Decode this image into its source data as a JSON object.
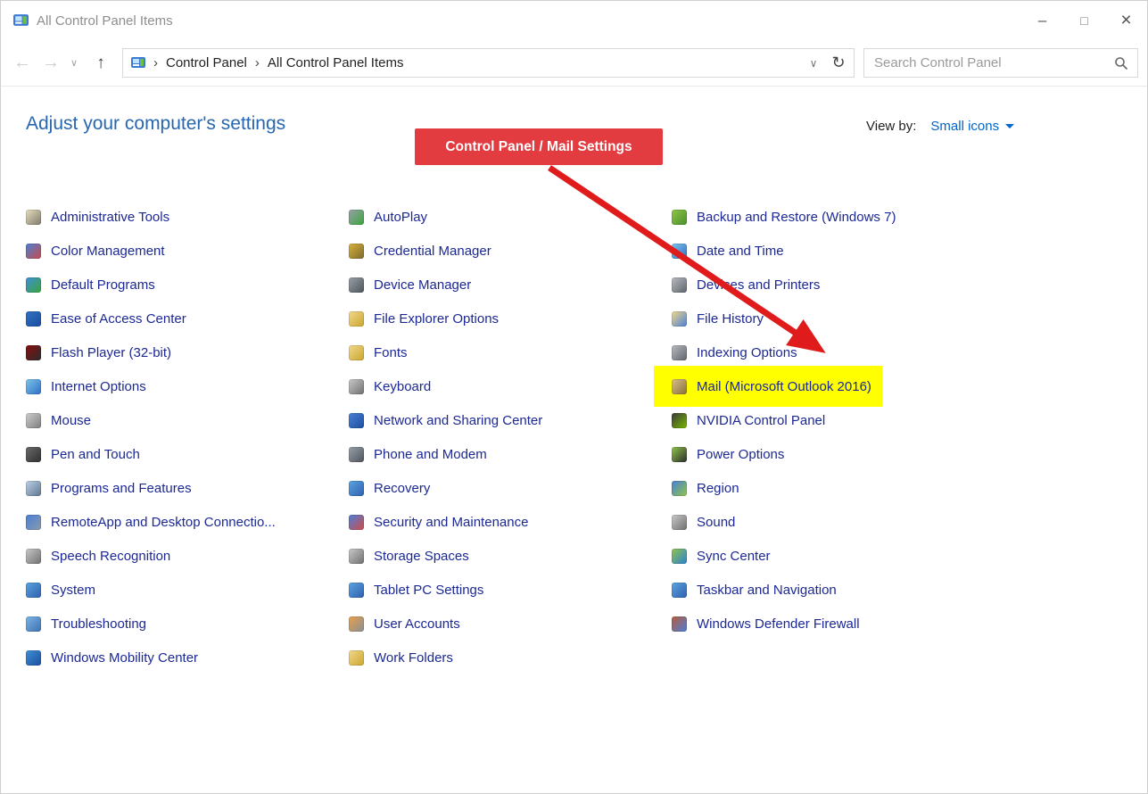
{
  "window": {
    "title": "All Control Panel Items",
    "controls": {
      "minimize": "–",
      "maximize": "□",
      "close": "×"
    }
  },
  "navbar": {
    "icons": {
      "back": "←",
      "forward": "→",
      "history_chevron": "∨",
      "up": "↑",
      "address_chevron": "∨",
      "refresh": "↻"
    },
    "separator": "›",
    "breadcrumb": [
      "Control Panel",
      "All Control Panel Items"
    ],
    "search_placeholder": "Search Control Panel"
  },
  "header": {
    "title": "Adjust your computer's settings",
    "view_by_label": "View by:",
    "view_by_value": "Small icons"
  },
  "annotation": {
    "callout_text": "Control Panel / Mail Settings",
    "callout_color": "#e23b40",
    "arrow_color": "#df1b1b",
    "highlight_color": "#ffff00"
  },
  "columns": [
    {
      "items": [
        {
          "label": "Administrative Tools",
          "icon": "administrative-tools-icon",
          "c1": "#e8ddbd",
          "c2": "#7f7a6b"
        },
        {
          "label": "Color Management",
          "icon": "color-management-icon",
          "c1": "#4a7fd6",
          "c2": "#c84b4b"
        },
        {
          "label": "Default Programs",
          "icon": "default-programs-icon",
          "c1": "#3f8fd6",
          "c2": "#39a53c"
        },
        {
          "label": "Ease of Access Center",
          "icon": "ease-of-access-icon",
          "c1": "#2f6fc4",
          "c2": "#1d4f9e"
        },
        {
          "label": "Flash Player (32-bit)",
          "icon": "flash-player-icon",
          "c1": "#8a0f0f",
          "c2": "#2b2b2b"
        },
        {
          "label": "Internet Options",
          "icon": "internet-options-icon",
          "c1": "#7ec4ea",
          "c2": "#2f6fc4"
        },
        {
          "label": "Mouse",
          "icon": "mouse-icon",
          "c1": "#cfcfcf",
          "c2": "#7d7d7d"
        },
        {
          "label": "Pen and Touch",
          "icon": "pen-and-touch-icon",
          "c1": "#6b6b6b",
          "c2": "#2f2f2f"
        },
        {
          "label": "Programs and Features",
          "icon": "programs-and-features-icon",
          "c1": "#bcd2ea",
          "c2": "#5f768e"
        },
        {
          "label": "RemoteApp and Desktop Connectio...",
          "icon": "remoteapp-icon",
          "c1": "#4a7fd6",
          "c2": "#8a9aac"
        },
        {
          "label": "Speech Recognition",
          "icon": "speech-recognition-icon",
          "c1": "#c9c9c9",
          "c2": "#6f6f6f"
        },
        {
          "label": "System",
          "icon": "system-icon",
          "c1": "#5aa5e0",
          "c2": "#2f5fae"
        },
        {
          "label": "Troubleshooting",
          "icon": "troubleshooting-icon",
          "c1": "#7ab6e8",
          "c2": "#3f6fb0"
        },
        {
          "label": "Windows Mobility Center",
          "icon": "windows-mobility-center-icon",
          "c1": "#3f8fd6",
          "c2": "#1d4f9e"
        }
      ]
    },
    {
      "items": [
        {
          "label": "AutoPlay",
          "icon": "autoplay-icon",
          "c1": "#9aa0a8",
          "c2": "#39a53c"
        },
        {
          "label": "Credential Manager",
          "icon": "credential-manager-icon",
          "c1": "#d9b13b",
          "c2": "#7c6a2e"
        },
        {
          "label": "Device Manager",
          "icon": "device-manager-icon",
          "c1": "#9aa0a8",
          "c2": "#4f555c"
        },
        {
          "label": "File Explorer Options",
          "icon": "file-explorer-options-icon",
          "c1": "#f2d98c",
          "c2": "#caa52e"
        },
        {
          "label": "Fonts",
          "icon": "fonts-icon",
          "c1": "#f2d98c",
          "c2": "#caa52e"
        },
        {
          "label": "Keyboard",
          "icon": "keyboard-icon",
          "c1": "#c9c9c9",
          "c2": "#6f6f6f"
        },
        {
          "label": "Network and Sharing Center",
          "icon": "network-sharing-icon",
          "c1": "#4a7fd6",
          "c2": "#1d4f9e"
        },
        {
          "label": "Phone and Modem",
          "icon": "phone-modem-icon",
          "c1": "#9aa0a8",
          "c2": "#4f555c"
        },
        {
          "label": "Recovery",
          "icon": "recovery-icon",
          "c1": "#5aa5e0",
          "c2": "#2f5fae"
        },
        {
          "label": "Security and Maintenance",
          "icon": "security-maintenance-icon",
          "c1": "#4a7fd6",
          "c2": "#d04b4b"
        },
        {
          "label": "Storage Spaces",
          "icon": "storage-spaces-icon",
          "c1": "#c9c9c9",
          "c2": "#6f6f6f"
        },
        {
          "label": "Tablet PC Settings",
          "icon": "tablet-pc-icon",
          "c1": "#5aa5e0",
          "c2": "#2f5fae"
        },
        {
          "label": "User Accounts",
          "icon": "user-accounts-icon",
          "c1": "#e8a04a",
          "c2": "#8a8f96"
        },
        {
          "label": "Work Folders",
          "icon": "work-folders-icon",
          "c1": "#f2d98c",
          "c2": "#caa52e"
        }
      ]
    },
    {
      "items": [
        {
          "label": "Backup and Restore (Windows 7)",
          "icon": "backup-restore-icon",
          "c1": "#8fc64a",
          "c2": "#4a8f2a"
        },
        {
          "label": "Date and Time",
          "icon": "date-time-icon",
          "c1": "#7ec4ea",
          "c2": "#2f6fc4"
        },
        {
          "label": "Devices and Printers",
          "icon": "devices-printers-icon",
          "c1": "#b8bcc2",
          "c2": "#5f646b"
        },
        {
          "label": "File History",
          "icon": "file-history-icon",
          "c1": "#f2d98c",
          "c2": "#4a7fd6"
        },
        {
          "label": "Indexing Options",
          "icon": "indexing-options-icon",
          "c1": "#b8bcc2",
          "c2": "#5f646b"
        },
        {
          "label": "Mail (Microsoft Outlook 2016)",
          "icon": "mail-icon",
          "c1": "#d8c08a",
          "c2": "#8a6f3a",
          "highlight": true
        },
        {
          "label": "NVIDIA Control Panel",
          "icon": "nvidia-icon",
          "c1": "#3a3a3a",
          "c2": "#76b900"
        },
        {
          "label": "Power Options",
          "icon": "power-options-icon",
          "c1": "#8fc64a",
          "c2": "#2b2b2b"
        },
        {
          "label": "Region",
          "icon": "region-icon",
          "c1": "#4a7fd6",
          "c2": "#8fc64a"
        },
        {
          "label": "Sound",
          "icon": "sound-icon",
          "c1": "#c9c9c9",
          "c2": "#6f6f6f"
        },
        {
          "label": "Sync Center",
          "icon": "sync-center-icon",
          "c1": "#8fc64a",
          "c2": "#2a7fd4"
        },
        {
          "label": "Taskbar and Navigation",
          "icon": "taskbar-icon",
          "c1": "#5aa5e0",
          "c2": "#2f5fae"
        },
        {
          "label": "Windows Defender Firewall",
          "icon": "firewall-icon",
          "c1": "#b85c3a",
          "c2": "#4a7fd6"
        }
      ]
    }
  ]
}
